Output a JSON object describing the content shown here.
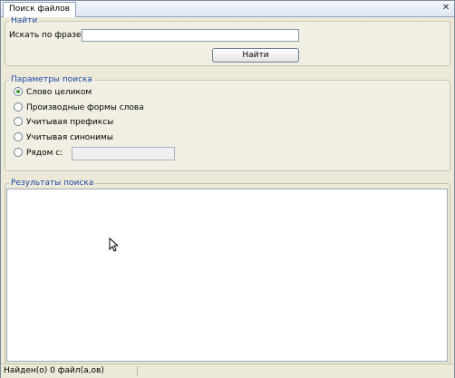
{
  "window": {
    "tab_title": "Поиск файлов",
    "close_icon": "close-icon"
  },
  "find_group": {
    "legend": "Найти",
    "search_label": "Искать по фразе:",
    "search_value": "",
    "find_button": "Найти"
  },
  "params_group": {
    "legend": "Параметры поиска",
    "options": [
      {
        "label": "Слово целиком",
        "checked": true
      },
      {
        "label": "Производные формы слова",
        "checked": false
      },
      {
        "label": "Учитывая префиксы",
        "checked": false
      },
      {
        "label": "Учитывая синонимы",
        "checked": false
      },
      {
        "label": "Рядом с:",
        "checked": false
      }
    ],
    "near_value": ""
  },
  "results_group": {
    "legend": "Результаты поиска"
  },
  "status": {
    "text": "Найден(о) 0 файл(а,ов)"
  },
  "colors": {
    "legend_text": "#1c49a8",
    "radio_checked": "#3f9a3f",
    "background": "#ece9d8"
  }
}
